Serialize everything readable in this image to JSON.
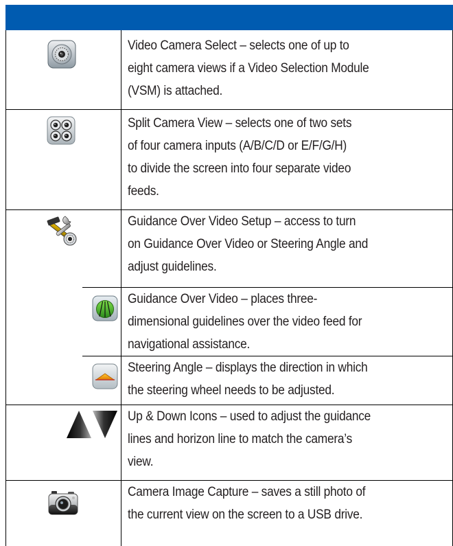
{
  "table": {
    "header_color": "#005bb0",
    "rows": [
      {
        "icon": "video-camera-select-icon",
        "lines": [
          "Video Camera Select – selects one of up to",
          "eight camera views if a Video Selection Module",
          "(VSM) is attached."
        ]
      },
      {
        "icon": "split-camera-view-icon",
        "lines": [
          "Split Camera View – selects one of two sets",
          "of four camera inputs (A/B/C/D or E/F/G/H)",
          "to divide the screen into four separate video",
          "feeds."
        ]
      },
      {
        "icon": "guidance-over-video-setup-icon",
        "lines": [
          "Guidance Over Video Setup – access to turn",
          "on Guidance Over Video or Steering Angle and",
          "adjust guidelines."
        ]
      },
      {
        "icon": "guidance-over-video-icon",
        "lines": [
          "Guidance Over Video – places three-",
          "dimensional guidelines over the video feed for",
          "navigational assistance."
        ]
      },
      {
        "icon": "steering-angle-icon",
        "lines": [
          "Steering Angle – displays the direction in which",
          "the steering wheel needs to be adjusted."
        ]
      },
      {
        "icon": "up-down-icons",
        "lines": [
          "Up & Down Icons – used to adjust the guidance",
          "lines and horizon line to match the camera’s",
          "view."
        ]
      },
      {
        "icon": "camera-image-capture-icon",
        "lines": [
          "Camera Image Capture – saves a still photo of",
          "the current view on the screen to a USB drive."
        ]
      }
    ]
  }
}
